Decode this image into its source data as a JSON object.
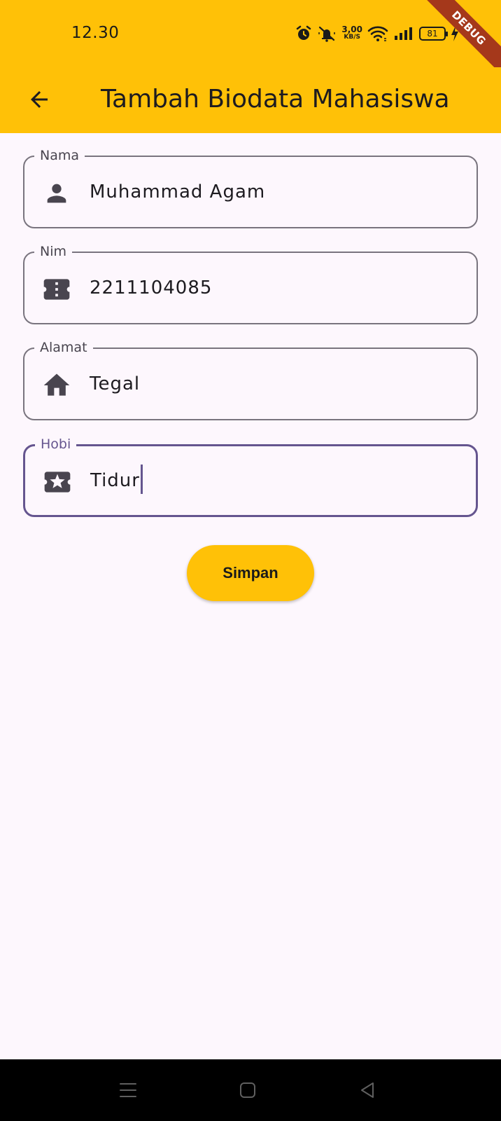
{
  "status_bar": {
    "time": "12.30",
    "net_speed_value": "3,00",
    "net_speed_unit": "KB/S",
    "battery_level": "81",
    "icons": [
      "alarm-icon",
      "mute-icon",
      "wifi-icon",
      "signal-icon",
      "battery-icon",
      "charging-icon"
    ]
  },
  "debug_banner": "DEBUG",
  "app_bar": {
    "title": "Tambah Biodata Mahasiswa",
    "back_icon": "arrow-back-icon"
  },
  "form": {
    "fields": [
      {
        "label": "Nama",
        "value": "Muhammad Agam",
        "icon": "person-icon"
      },
      {
        "label": "Nim",
        "value": "2211104085",
        "icon": "ticket-icon"
      },
      {
        "label": "Alamat",
        "value": "Tegal",
        "icon": "home-icon"
      },
      {
        "label": "Hobi",
        "value": "Tidur",
        "icon": "star-ticket-icon",
        "focused": true
      }
    ],
    "submit_label": "Simpan"
  },
  "nav_bar": {
    "icons": [
      "menu-icon",
      "home-square-icon",
      "back-triangle-icon"
    ]
  },
  "colors": {
    "primary": "#ffc107",
    "focus": "#65558f",
    "background": "#fdf7fd",
    "debug": "#a5381b"
  }
}
